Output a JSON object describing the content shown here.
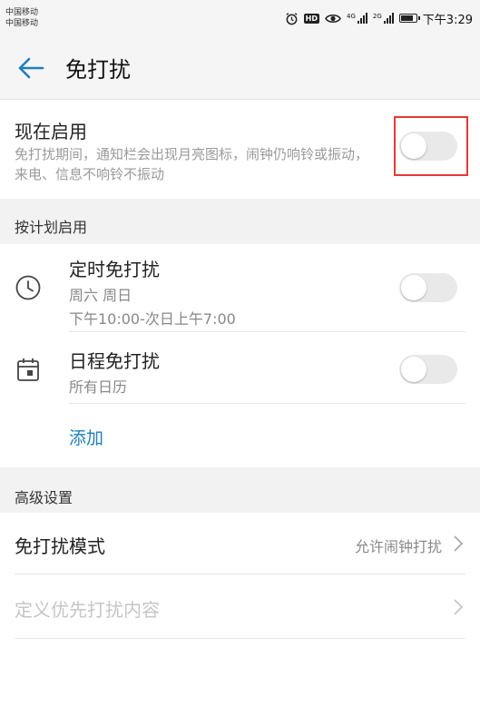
{
  "status_bar": {
    "carrier_1": "中国移动",
    "carrier_2": "中国移动",
    "hd_badge": "HD",
    "signal_1_tag": "4G",
    "signal_2_tag": "2G",
    "time": "下午3:29"
  },
  "app_bar": {
    "title": "免打扰",
    "back_icon": "arrow-left-icon",
    "accent_color": "#1f7fbd"
  },
  "now_enable": {
    "title": "现在启用",
    "description": "免打扰期间，通知栏会出现月亮图标，闹钟仍响铃或振动，来电、信息不响铃不振动",
    "toggle_on": false,
    "annotation_color": "#e53935"
  },
  "schedule": {
    "header": "按计划启用",
    "items": [
      {
        "title": "定时免打扰",
        "sub_1": "周六 周日",
        "sub_2": "下午10:00-次日上午7:00",
        "icon": "clock-icon",
        "toggle_on": false
      },
      {
        "title": "日程免打扰",
        "sub_1": "所有日历",
        "icon": "calendar-icon",
        "toggle_on": false
      }
    ],
    "add_label": "添加"
  },
  "advanced": {
    "header": "高级设置",
    "mode_label": "免打扰模式",
    "mode_value": "允许闹钟打扰",
    "priority_label": "定义优先打扰内容",
    "priority_enabled": false
  }
}
